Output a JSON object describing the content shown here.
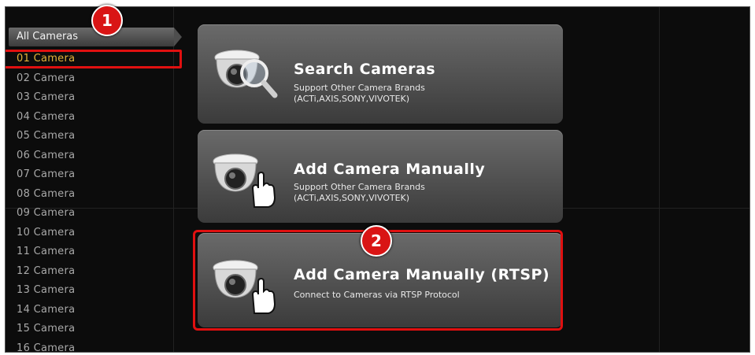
{
  "sidebar": {
    "header": "All Cameras",
    "items": [
      "01 Camera",
      "02 Camera",
      "03 Camera",
      "04 Camera",
      "05 Camera",
      "06 Camera",
      "07 Camera",
      "08 Camera",
      "09 Camera",
      "10 Camera",
      "11 Camera",
      "12 Camera",
      "13 Camera",
      "14 Camera",
      "15 Camera",
      "16 Camera"
    ],
    "selected_index": 0
  },
  "callouts": {
    "one": "1",
    "two": "2"
  },
  "options": [
    {
      "title": "Search Cameras",
      "sub1": "Support Other Camera Brands",
      "sub2": "(ACTi,AXIS,SONY,VIVOTEK)",
      "icon": "camera-search-icon"
    },
    {
      "title": "Add Camera Manually",
      "sub1": "Support Other Camera Brands",
      "sub2": "(ACTi,AXIS,SONY,VIVOTEK)",
      "icon": "camera-hand-icon"
    },
    {
      "title": "Add Camera Manually (RTSP)",
      "sub1": "Connect to Cameras via RTSP Protocol",
      "icon": "camera-hand-icon"
    }
  ],
  "colors": {
    "highlight": "#e01010",
    "selected_text": "#e2b23a"
  }
}
